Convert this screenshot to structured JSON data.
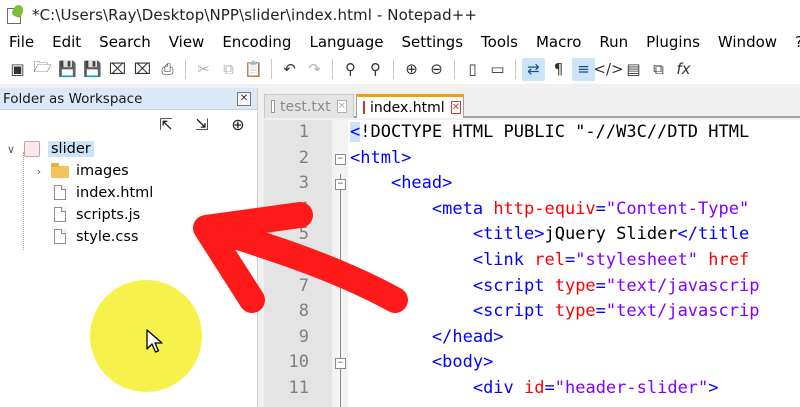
{
  "window": {
    "title": "*C:\\Users\\Ray\\Desktop\\NPP\\slider\\index.html - Notepad++"
  },
  "menu": [
    "File",
    "Edit",
    "Search",
    "View",
    "Encoding",
    "Language",
    "Settings",
    "Tools",
    "Macro",
    "Run",
    "Plugins",
    "Window",
    "?"
  ],
  "toolbar": {
    "icons": [
      "new-file-icon",
      "open-folder-icon",
      "save-icon",
      "save-all-icon",
      "close-icon",
      "close-all-icon",
      "print-icon",
      "cut-icon",
      "copy-icon",
      "paste-icon",
      "undo-icon",
      "redo-icon",
      "find-icon",
      "replace-icon",
      "zoom-in-icon",
      "zoom-out-icon",
      "sync-vertical-icon",
      "sync-horizontal-icon",
      "word-wrap-icon",
      "show-all-chars-icon",
      "indent-guide-icon",
      "xml-tag-icon",
      "map-icon",
      "doc-list-icon",
      "function-list-icon"
    ]
  },
  "panel": {
    "title": "Folder as Workspace",
    "close_label": "✕",
    "tools": [
      "collapse-all-icon",
      "expand-all-icon",
      "locate-icon"
    ]
  },
  "tree": {
    "root": "slider",
    "items": [
      {
        "label": "images",
        "type": "folder"
      },
      {
        "label": "index.html",
        "type": "file"
      },
      {
        "label": "scripts.js",
        "type": "file"
      },
      {
        "label": "style.css",
        "type": "file"
      }
    ]
  },
  "tabs": [
    {
      "label": "test.txt",
      "active": false
    },
    {
      "label": "index.html",
      "active": true
    }
  ],
  "tab_close_label": "✕",
  "editor": {
    "lines": [
      {
        "num": "1",
        "parts": [
          [
            "first",
            "<"
          ],
          [
            "doctype",
            "!DOCTYPE HTML PUBLIC \"-//W3C//DTD HTML"
          ]
        ]
      },
      {
        "num": "2",
        "parts": [
          [
            "tag",
            "<html>"
          ]
        ]
      },
      {
        "num": "3",
        "parts": [
          [
            "plain",
            "    "
          ],
          [
            "tag",
            "<head>"
          ]
        ]
      },
      {
        "num": "4",
        "parts": [
          [
            "plain",
            "        "
          ],
          [
            "tag",
            "<meta "
          ],
          [
            "attr",
            "http-equiv"
          ],
          [
            "tag",
            "="
          ],
          [
            "val",
            "\"Content-Type\""
          ]
        ]
      },
      {
        "num": "5",
        "parts": [
          [
            "plain",
            "            "
          ],
          [
            "tag",
            "<title>"
          ],
          [
            "doctype",
            "jQuery Slider"
          ],
          [
            "tag",
            "</title"
          ]
        ]
      },
      {
        "num": "6",
        "parts": [
          [
            "plain",
            "            "
          ],
          [
            "tag",
            "<link "
          ],
          [
            "attr",
            "rel"
          ],
          [
            "tag",
            "="
          ],
          [
            "val",
            "\"stylesheet\" "
          ],
          [
            "attr",
            "href"
          ]
        ]
      },
      {
        "num": "7",
        "parts": [
          [
            "plain",
            "            "
          ],
          [
            "tag",
            "<script "
          ],
          [
            "attr",
            "type"
          ],
          [
            "tag",
            "="
          ],
          [
            "val",
            "\"text/javascrip"
          ]
        ]
      },
      {
        "num": "8",
        "parts": [
          [
            "plain",
            "            "
          ],
          [
            "tag",
            "<script "
          ],
          [
            "attr",
            "type"
          ],
          [
            "tag",
            "="
          ],
          [
            "val",
            "\"text/javascrip"
          ]
        ]
      },
      {
        "num": "9",
        "parts": [
          [
            "plain",
            "        "
          ],
          [
            "tag",
            "</head>"
          ]
        ]
      },
      {
        "num": "10",
        "parts": [
          [
            "plain",
            "        "
          ],
          [
            "tag",
            "<body>"
          ]
        ]
      },
      {
        "num": "11",
        "parts": [
          [
            "plain",
            "            "
          ],
          [
            "tag",
            "<div "
          ],
          [
            "attr",
            "id"
          ],
          [
            "tag",
            "="
          ],
          [
            "val",
            "\"header-slider\""
          ],
          [
            "tag",
            ">"
          ]
        ]
      }
    ]
  },
  "colors": {
    "tag": "#0000ff",
    "attr": "#ff0000",
    "value": "#8000ff",
    "arrow": "#ff1a1a",
    "highlight": "#f6f02c",
    "tab_accent": "#f0a000"
  }
}
